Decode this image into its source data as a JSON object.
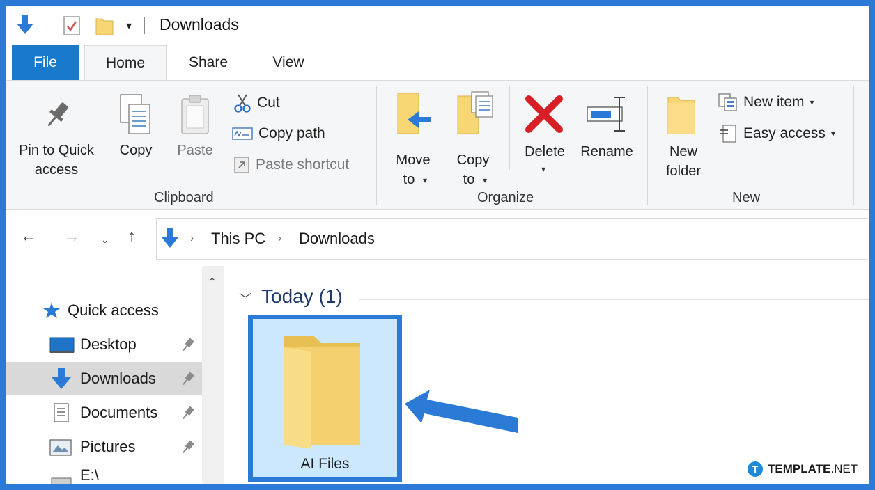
{
  "window": {
    "title": "Downloads",
    "qa_dropdown_icon": "quick-access-customize-icon"
  },
  "tabs": [
    {
      "label": "File"
    },
    {
      "label": "Home"
    },
    {
      "label": "Share"
    },
    {
      "label": "View"
    }
  ],
  "ribbon": {
    "clipboard": {
      "group_label": "Clipboard",
      "pin_line1": "Pin to Quick",
      "pin_line2": "access",
      "copy": "Copy",
      "paste": "Paste",
      "cut": "Cut",
      "copy_path": "Copy path",
      "paste_shortcut": "Paste shortcut"
    },
    "organize": {
      "group_label": "Organize",
      "move_line1": "Move",
      "move_line2": "to",
      "copy_line1": "Copy",
      "copy_line2": "to",
      "delete": "Delete",
      "rename": "Rename"
    },
    "new": {
      "group_label": "New",
      "new_folder_line1": "New",
      "new_folder_line2": "folder",
      "new_item": "New item",
      "easy_access": "Easy access"
    }
  },
  "address": {
    "crumbs": [
      "This PC",
      "Downloads"
    ]
  },
  "nav": {
    "items": [
      {
        "label": "Quick access",
        "icon": "quick-access-star-icon",
        "pinned": false
      },
      {
        "label": "Desktop",
        "icon": "desktop-icon",
        "pinned": true
      },
      {
        "label": "Downloads",
        "icon": "downloads-arrow-icon",
        "pinned": true,
        "selected": true
      },
      {
        "label": "Documents",
        "icon": "documents-icon",
        "pinned": true
      },
      {
        "label": "Pictures",
        "icon": "pictures-icon",
        "pinned": true
      },
      {
        "label": "E:\\",
        "icon": "drive-icon",
        "pinned": true
      }
    ]
  },
  "content": {
    "group_header": "Today (1)",
    "items": [
      {
        "name": "AI Files",
        "icon": "folder-icon",
        "selected": true
      }
    ]
  },
  "annotation": {
    "arrow_color": "#2b7ad6",
    "highlight_color": "#2b7ad6"
  },
  "watermark": {
    "brand_bold": "TEMPLATE",
    "brand_light": ".NET",
    "badge": "T"
  },
  "colors": {
    "accent": "#1979ca",
    "frame": "#2b7ad6",
    "selection": "#cce8ff",
    "delete_red": "#d91f26",
    "folder_yellow": "#f7d774"
  }
}
